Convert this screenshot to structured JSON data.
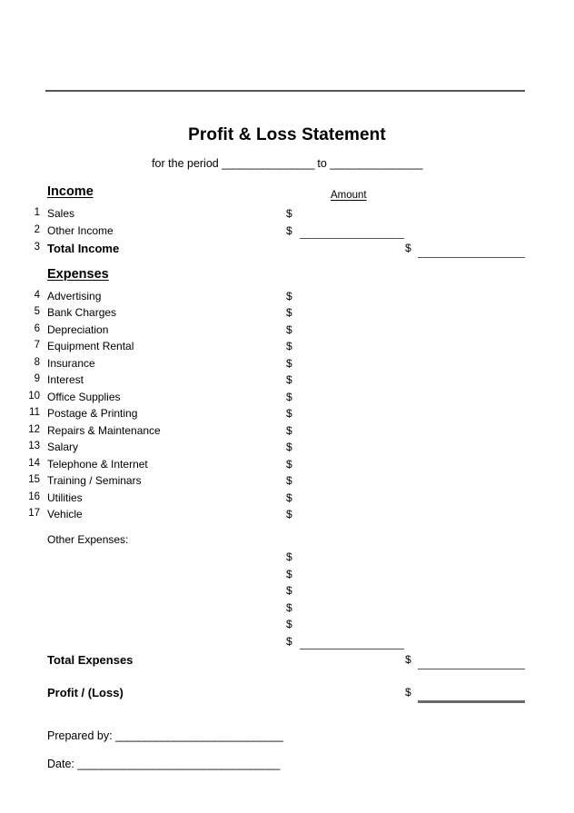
{
  "document": {
    "title": "Profit & Loss Statement",
    "period_prefix": "for the period",
    "period_blank_1": "________________",
    "period_connector": "to",
    "period_blank_2": "________________"
  },
  "columns": {
    "amount_header": "Amount",
    "currency_symbol": "$"
  },
  "income": {
    "heading": "Income",
    "rows": [
      {
        "num": "1",
        "label": "Sales"
      },
      {
        "num": "2",
        "label": "Other Income"
      }
    ],
    "total": {
      "num": "3",
      "label": "Total Income"
    }
  },
  "expenses": {
    "heading": "Expenses",
    "rows": [
      {
        "num": "4",
        "label": "Advertising"
      },
      {
        "num": "5",
        "label": "Bank Charges"
      },
      {
        "num": "6",
        "label": "Depreciation"
      },
      {
        "num": "7",
        "label": "Equipment Rental"
      },
      {
        "num": "8",
        "label": "Insurance"
      },
      {
        "num": "9",
        "label": "Interest"
      },
      {
        "num": "10",
        "label": "Office Supplies"
      },
      {
        "num": "11",
        "label": "Postage & Printing"
      },
      {
        "num": "12",
        "label": "Repairs & Maintenance"
      },
      {
        "num": "13",
        "label": "Salary"
      },
      {
        "num": "14",
        "label": "Telephone & Internet"
      },
      {
        "num": "15",
        "label": "Training / Seminars"
      },
      {
        "num": "16",
        "label": "Utilities"
      },
      {
        "num": "17",
        "label": "Vehicle"
      }
    ],
    "other_label": "Other Expenses:",
    "other_blank_count": 6,
    "total_label": "Total Expenses"
  },
  "result": {
    "label": "Profit / (Loss)"
  },
  "footer": {
    "prepared_by_label": "Prepared by:",
    "prepared_by_blank": "_____________________________",
    "date_label": "Date:",
    "date_blank": "___________________________________"
  },
  "colors": {
    "rule": "#555555",
    "thick_rule": "#6a6a6a",
    "text": "#000000",
    "background": "#ffffff"
  }
}
